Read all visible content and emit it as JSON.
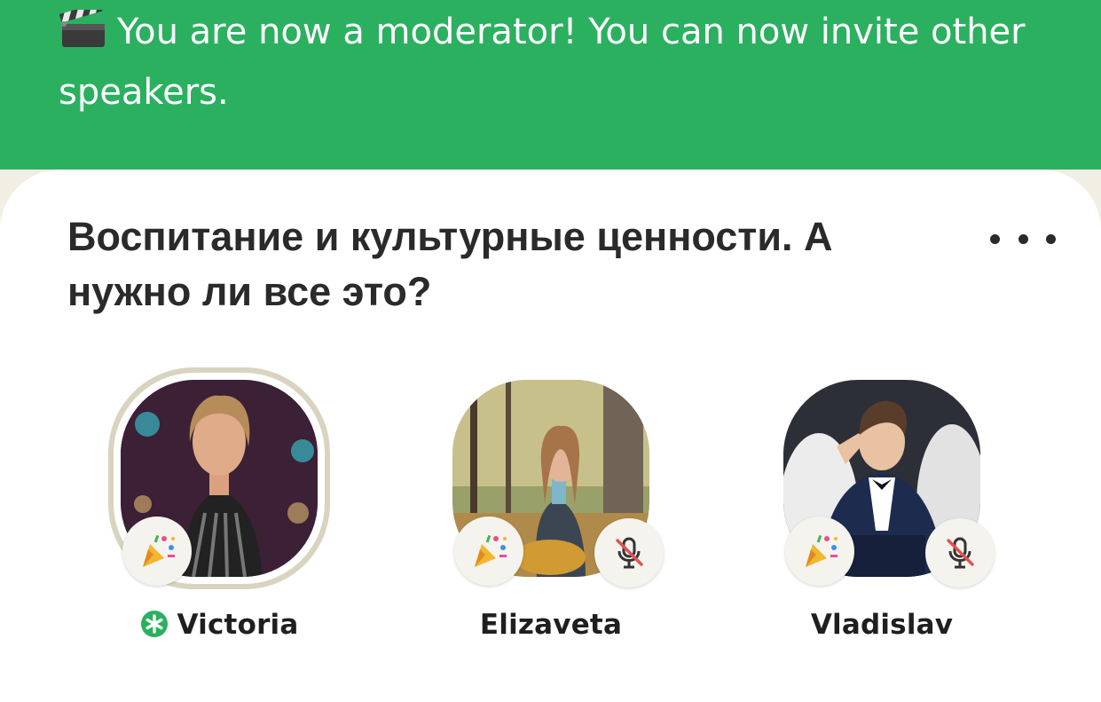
{
  "banner": {
    "icon": "clapperboard-icon",
    "message": "You are now a moderator! You can now invite other speakers.",
    "background_color": "#2bb05f"
  },
  "room": {
    "title": "Воспитание и культурные ценности. А нужно ли все это?",
    "menu_icon": "more-horizontal-icon"
  },
  "speakers": [
    {
      "name": "Victoria",
      "is_moderator": true,
      "is_speaking": true,
      "muted": false,
      "badge": "party-popper-icon"
    },
    {
      "name": "Elizaveta",
      "is_moderator": false,
      "is_speaking": false,
      "muted": true,
      "badge": "party-popper-icon"
    },
    {
      "name": "Vladislav",
      "is_moderator": false,
      "is_speaking": false,
      "muted": true,
      "badge": "party-popper-icon"
    }
  ],
  "colors": {
    "moderator_badge": "#2bb05f",
    "speaking_ring": "#d9d4c0",
    "mute_slash": "#e0524f"
  }
}
